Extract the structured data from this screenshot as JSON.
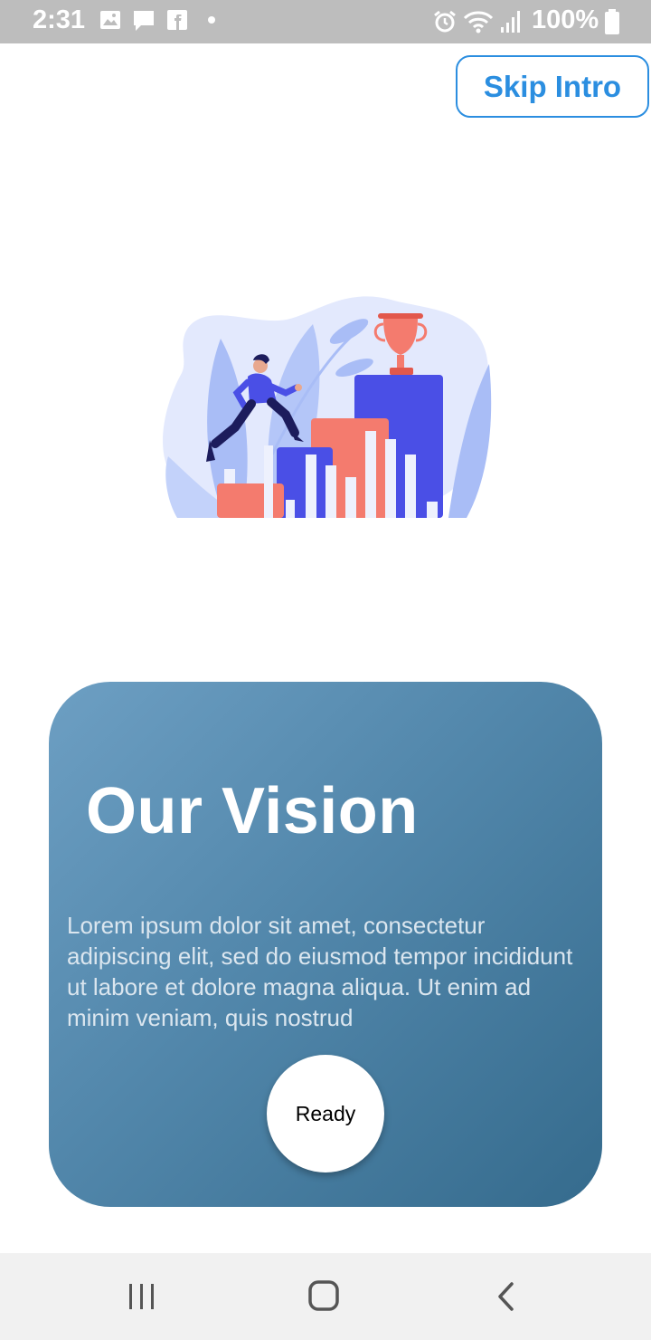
{
  "status_bar": {
    "time": "2:31",
    "battery": "100%",
    "left_icons": [
      "image-icon",
      "message-icon",
      "facebook-icon",
      "dot-icon"
    ],
    "right_icons": [
      "alarm-icon",
      "wifi-icon",
      "signal-icon",
      "battery-icon"
    ]
  },
  "header": {
    "skip_label": "Skip Intro"
  },
  "illustration": {
    "icon": "running-to-trophy-illustration",
    "colors": {
      "blue": "#4a4fe6",
      "coral": "#f47b6e",
      "leaf": "#9fb6f5",
      "blob": "#e3e9fd"
    }
  },
  "card": {
    "title": "Our Vision",
    "body": "Lorem ipsum dolor sit amet, consectetur adipiscing elit, sed do eiusmod tempor incididunt ut labore et dolore magna aliqua. Ut enim ad minim veniam, quis nostrud",
    "button_label": "Ready",
    "gradient": [
      "#6d9fc3",
      "#356b8d"
    ]
  },
  "nav_bar": {
    "items": [
      "recent-apps-icon",
      "home-icon",
      "back-icon"
    ]
  }
}
